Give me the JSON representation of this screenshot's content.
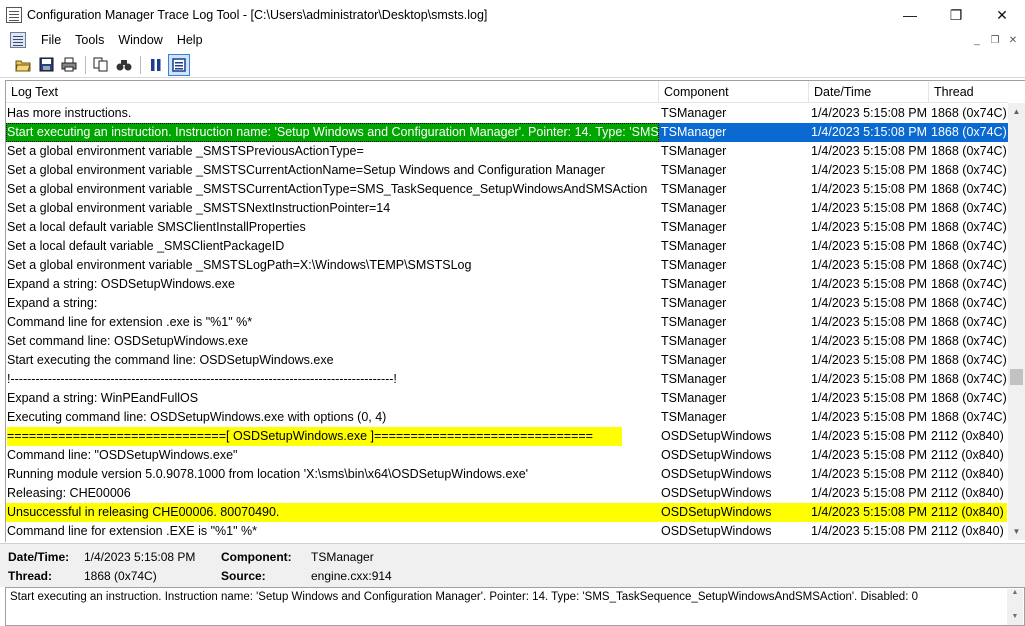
{
  "window": {
    "title": "Configuration Manager Trace Log Tool - [C:\\Users\\administrator\\Desktop\\smsts.log]",
    "minimize": "—",
    "restore": "❐",
    "close": "✕"
  },
  "menu": {
    "items": [
      "File",
      "Tools",
      "Window",
      "Help"
    ]
  },
  "toolbar": {
    "icons": [
      "open-icon",
      "save-icon",
      "print-icon",
      "copy-icon",
      "find-icon",
      "pause-icon",
      "highlight-icon"
    ]
  },
  "log": {
    "columns": [
      "Log Text",
      "Component",
      "Date/Time",
      "Thread"
    ],
    "rows": [
      {
        "text": "Has more instructions.",
        "component": "TSManager",
        "datetime": "1/4/2023 5:15:08 PM",
        "thread": "1868 (0x74C)",
        "style": "normal"
      },
      {
        "text": "Start executing an instruction. Instruction name: 'Setup Windows and Configuration Manager'.  Pointer: 14. Type: 'SMS_T...",
        "component": "TSManager",
        "datetime": "1/4/2023 5:15:08 PM",
        "thread": "1868 (0x74C)",
        "style": "selected"
      },
      {
        "text": "Set a global environment variable _SMSTSPreviousActionType=",
        "component": "TSManager",
        "datetime": "1/4/2023 5:15:08 PM",
        "thread": "1868 (0x74C)",
        "style": "normal"
      },
      {
        "text": "Set a global environment variable _SMSTSCurrentActionName=Setup Windows and Configuration Manager",
        "component": "TSManager",
        "datetime": "1/4/2023 5:15:08 PM",
        "thread": "1868 (0x74C)",
        "style": "normal"
      },
      {
        "text": "Set a global environment variable _SMSTSCurrentActionType=SMS_TaskSequence_SetupWindowsAndSMSAction",
        "component": "TSManager",
        "datetime": "1/4/2023 5:15:08 PM",
        "thread": "1868 (0x74C)",
        "style": "normal"
      },
      {
        "text": "Set a global environment variable _SMSTSNextInstructionPointer=14",
        "component": "TSManager",
        "datetime": "1/4/2023 5:15:08 PM",
        "thread": "1868 (0x74C)",
        "style": "normal"
      },
      {
        "text": "Set a local default variable SMSClientInstallProperties",
        "component": "TSManager",
        "datetime": "1/4/2023 5:15:08 PM",
        "thread": "1868 (0x74C)",
        "style": "normal"
      },
      {
        "text": "Set a local default variable _SMSClientPackageID",
        "component": "TSManager",
        "datetime": "1/4/2023 5:15:08 PM",
        "thread": "1868 (0x74C)",
        "style": "normal"
      },
      {
        "text": "Set a global environment variable _SMSTSLogPath=X:\\Windows\\TEMP\\SMSTSLog",
        "component": "TSManager",
        "datetime": "1/4/2023 5:15:08 PM",
        "thread": "1868 (0x74C)",
        "style": "normal"
      },
      {
        "text": "Expand a string: OSDSetupWindows.exe",
        "component": "TSManager",
        "datetime": "1/4/2023 5:15:08 PM",
        "thread": "1868 (0x74C)",
        "style": "normal"
      },
      {
        "text": "Expand a string:",
        "component": "TSManager",
        "datetime": "1/4/2023 5:15:08 PM",
        "thread": "1868 (0x74C)",
        "style": "normal"
      },
      {
        "text": "Command line for extension .exe is \"%1\" %*",
        "component": "TSManager",
        "datetime": "1/4/2023 5:15:08 PM",
        "thread": "1868 (0x74C)",
        "style": "normal"
      },
      {
        "text": "Set command line: OSDSetupWindows.exe",
        "component": "TSManager",
        "datetime": "1/4/2023 5:15:08 PM",
        "thread": "1868 (0x74C)",
        "style": "normal"
      },
      {
        "text": "Start executing the command line: OSDSetupWindows.exe",
        "component": "TSManager",
        "datetime": "1/4/2023 5:15:08 PM",
        "thread": "1868 (0x74C)",
        "style": "normal"
      },
      {
        "text": "!--------------------------------------------------------------------------------------------!",
        "component": "TSManager",
        "datetime": "1/4/2023 5:15:08 PM",
        "thread": "1868 (0x74C)",
        "style": "normal"
      },
      {
        "text": "Expand a string: WinPEandFullOS",
        "component": "TSManager",
        "datetime": "1/4/2023 5:15:08 PM",
        "thread": "1868 (0x74C)",
        "style": "normal"
      },
      {
        "text": "Executing command line: OSDSetupWindows.exe with options (0, 4)",
        "component": "TSManager",
        "datetime": "1/4/2023 5:15:08 PM",
        "thread": "1868 (0x74C)",
        "style": "normal"
      },
      {
        "text": "==============================[ OSDSetupWindows.exe ]==============================",
        "component": "OSDSetupWindows",
        "datetime": "1/4/2023 5:15:08 PM",
        "thread": "2112 (0x840)",
        "style": "warn-partial"
      },
      {
        "text": "Command line: \"OSDSetupWindows.exe\"",
        "component": "OSDSetupWindows",
        "datetime": "1/4/2023 5:15:08 PM",
        "thread": "2112 (0x840)",
        "style": "normal"
      },
      {
        "text": "Running module version 5.0.9078.1000 from location 'X:\\sms\\bin\\x64\\OSDSetupWindows.exe'",
        "component": "OSDSetupWindows",
        "datetime": "1/4/2023 5:15:08 PM",
        "thread": "2112 (0x840)",
        "style": "normal"
      },
      {
        "text": "Releasing: CHE00006",
        "component": "OSDSetupWindows",
        "datetime": "1/4/2023 5:15:08 PM",
        "thread": "2112 (0x840)",
        "style": "normal"
      },
      {
        "text": "Unsuccessful in releasing CHE00006. 80070490.",
        "component": "OSDSetupWindows",
        "datetime": "1/4/2023 5:15:08 PM",
        "thread": "2112 (0x840)",
        "style": "warn"
      },
      {
        "text": "Command line for extension .EXE is \"%1\" %*",
        "component": "OSDSetupWindows",
        "datetime": "1/4/2023 5:15:08 PM",
        "thread": "2112 (0x840)",
        "style": "normal"
      }
    ]
  },
  "details": {
    "datetime_label": "Date/Time:",
    "datetime_value": "1/4/2023 5:15:08 PM",
    "component_label": "Component:",
    "component_value": "TSManager",
    "thread_label": "Thread:",
    "thread_value": "1868 (0x74C)",
    "source_label": "Source:",
    "source_value": "engine.cxx:914"
  },
  "message": {
    "text": "Start executing an instruction. Instruction name: 'Setup Windows and Configuration Manager'.  Pointer: 14. Type: 'SMS_TaskSequence_SetupWindowsAndSMSAction'. Disabled: 0"
  },
  "colors": {
    "selection_blue": "#0a6ad1",
    "selection_green": "#00a600",
    "warning_yellow": "#ffff00"
  }
}
